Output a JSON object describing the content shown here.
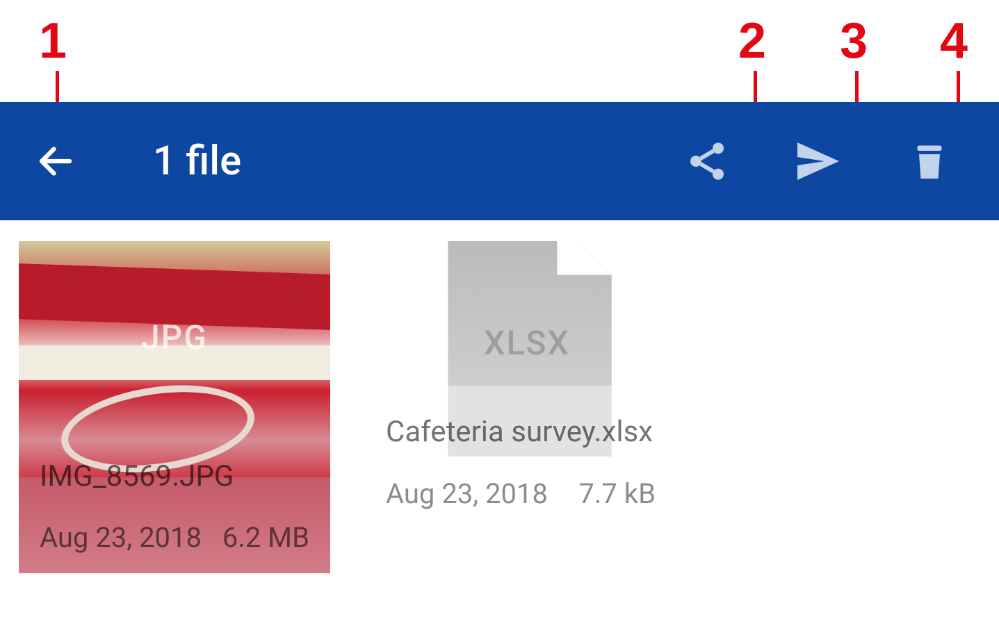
{
  "annotations": {
    "n1": "1",
    "n2": "2",
    "n3": "3",
    "n4": "4"
  },
  "toolbar": {
    "title": "1 file"
  },
  "files": [
    {
      "name": "IMG_8569.JPG",
      "type_label": "JPG",
      "date": "Aug 23, 2018",
      "size": "6.2 MB"
    },
    {
      "name": "Cafeteria survey.xlsx",
      "type_label": "XLSX",
      "date": "Aug 23, 2018",
      "size": "7.7 kB"
    }
  ]
}
